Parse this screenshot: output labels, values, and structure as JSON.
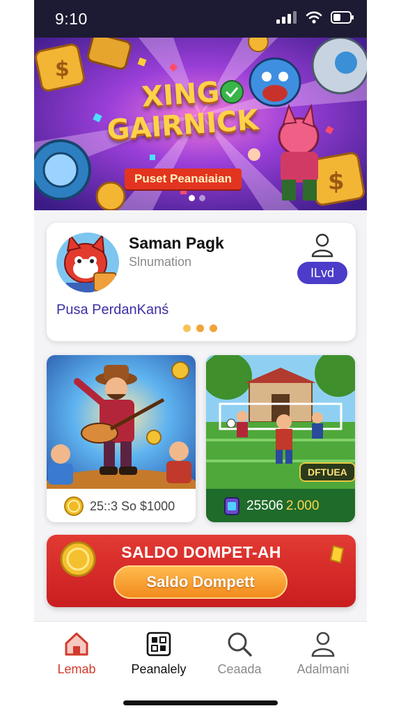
{
  "status_bar": {
    "time": "9:10",
    "icons": [
      "signal-icon",
      "wifi-icon",
      "battery-icon"
    ]
  },
  "banner": {
    "title": "XING\nGAIRNICK",
    "ribbon": "Puset Peanaiaian",
    "dots": {
      "count": 2,
      "active": 0
    }
  },
  "profile": {
    "name": "Saman Pagk",
    "subtitle": "Slnumation",
    "level": "ILvd",
    "link": "Pusa PerdanKanś",
    "dots": 3
  },
  "games": [
    {
      "name": "guitar-game",
      "footer": "25::3 So $1000",
      "icon": "coin-icon"
    },
    {
      "name": "soccer-game",
      "value1": "25506",
      "value2": "2.000",
      "tag": "DFTUEA",
      "icon": "gem-icon"
    }
  ],
  "wallet": {
    "title": "SALDO DOMPET-AH",
    "button": "Saldo Dompett"
  },
  "nav": [
    {
      "label": "Lemab",
      "icon": "home-icon",
      "active": true
    },
    {
      "label": "Peanalely",
      "icon": "grid-icon"
    },
    {
      "label": "Ceaada",
      "icon": "search-icon"
    },
    {
      "label": "Adalmani",
      "icon": "user-icon"
    }
  ],
  "colors": {
    "accent": "#4b3cc9",
    "active_nav": "#d13a2c",
    "wallet": "#d42a2a",
    "wallet_button": "#f5a232"
  }
}
